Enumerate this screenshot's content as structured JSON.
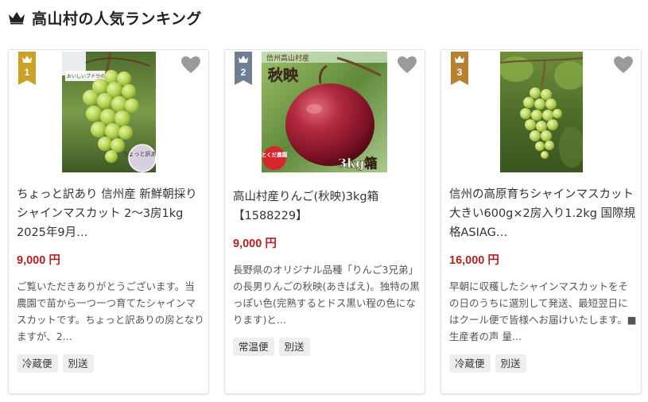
{
  "header": {
    "title": "高山村の人気ランキング",
    "icon": "crown-icon"
  },
  "colors": {
    "rank1": "#c9a227",
    "rank2": "#6f7f91",
    "rank3": "#b7822f",
    "price": "#b22222",
    "heart": "#9a9a9a"
  },
  "products": [
    {
      "rank": "1",
      "title": "ちょっと訳あり 信州産 新鮮朝採りシャインマスカット 2～3房1kg 2025年9月…",
      "price": "9,000 円",
      "description": "ご覧いただきありがとうございます。当農園で苗から一つ一つ育てたシャインマスカットです。ちょっと訳ありの房となりますが、2...",
      "tags": [
        "冷蔵便",
        "別送"
      ],
      "image": {
        "label": "grapes-image",
        "note_text": "おいしいブドウのシール",
        "sticker_text": "ちょっと訳あり"
      }
    },
    {
      "rank": "2",
      "title": "高山村産りんご(秋映)3kg箱【1588229】",
      "price": "9,000 円",
      "description": "長野県のオリジナル品種「りんご3兄弟」の長男りんごの秋映(あきばえ)。独特の黒っぽい色(完熟するとドス黒い程の色になります)と...",
      "tags": [
        "常温便",
        "別送"
      ],
      "image": {
        "label": "apple-image",
        "banner_text": "信州高山村産",
        "variety_text": "秋映",
        "seal_text": "とくだ農園",
        "box_text": "3kg箱"
      }
    },
    {
      "rank": "3",
      "title": "信州の高原育ちシャインマスカット 大きい600g×2房入り1.2kg 国際規格ASIAG…",
      "price": "16,000 円",
      "description": "早朝に収穫したシャインマスカットをその日のうちに選別して発送、最短翌日にはクール便で皆様へお届けいたします。■生産者の声 量...",
      "tags": [
        "冷蔵便",
        "別送"
      ],
      "image": {
        "label": "vine-grapes-image"
      }
    }
  ]
}
